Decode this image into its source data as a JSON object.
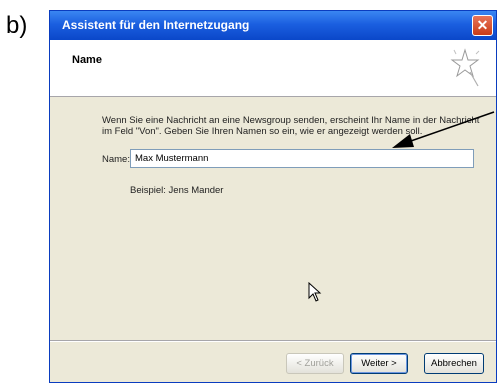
{
  "panel_label": "b)",
  "window": {
    "title": "Assistent für den Internetzugang",
    "close_symbol": "✕"
  },
  "header": {
    "title": "Name",
    "icon": "wizard-star-icon"
  },
  "body": {
    "description": "Wenn Sie eine Nachricht an eine Newsgroup senden, erscheint Ihr Name in der Nachricht im Feld \"Von\". Geben Sie Ihren Namen so ein, wie er angezeigt werden soll.",
    "name_label": "Name:",
    "name_value": "Max Mustermann",
    "example": "Beispiel: Jens Mander"
  },
  "buttons": {
    "back": "< Zurück",
    "next": "Weiter >",
    "cancel": "Abbrechen"
  },
  "icons": {
    "cursor": "mouse-pointer-icon",
    "annotation": "annotation-arrow-icon"
  }
}
